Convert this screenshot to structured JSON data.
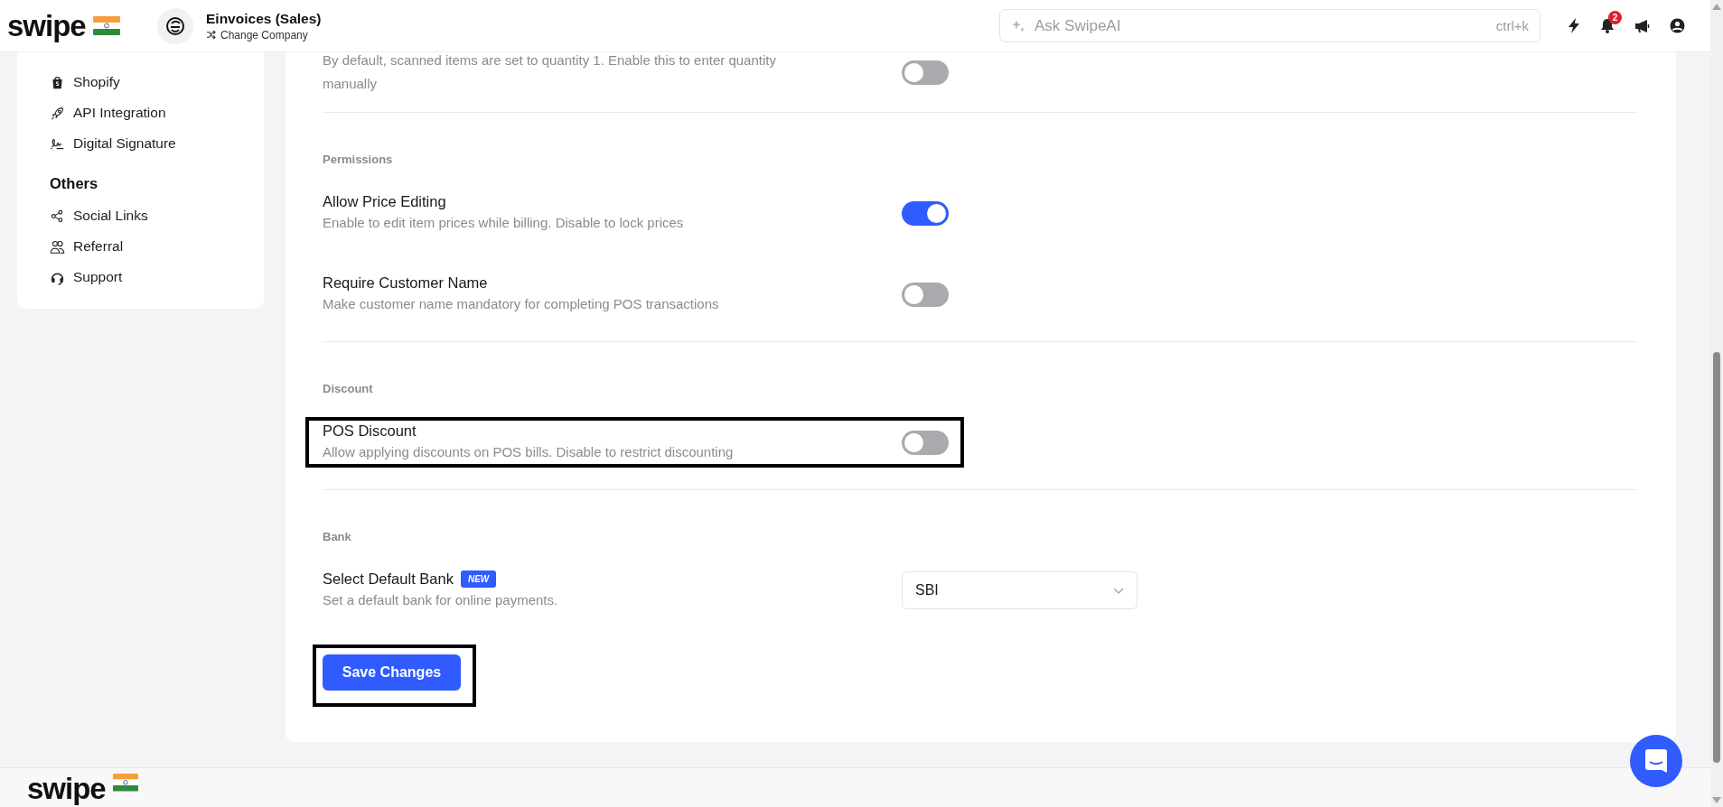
{
  "header": {
    "logo": "swipe",
    "company": {
      "name": "Einvoices (Sales)",
      "action": "Change Company"
    },
    "search": {
      "placeholder": "Ask SwipeAI",
      "shortcut": "ctrl+k"
    },
    "notifications": {
      "count": "2"
    }
  },
  "sidebar": {
    "groups": [
      {
        "items": [
          {
            "label": "Shopify"
          },
          {
            "label": "API Integration"
          },
          {
            "label": "Digital Signature"
          }
        ]
      },
      {
        "title": "Others",
        "items": [
          {
            "label": "Social Links"
          },
          {
            "label": "Referral"
          },
          {
            "label": "Support"
          }
        ]
      }
    ]
  },
  "settings": {
    "sections": [
      {
        "rows": [
          {
            "kind": "toggle",
            "description": "By default, scanned items are set to quantity 1. Enable this to enter quantity manually",
            "on": false,
            "highlighted": false
          }
        ]
      },
      {
        "title": "Permissions",
        "rows": [
          {
            "kind": "toggle",
            "title": "Allow Price Editing",
            "description": "Enable to edit item prices while billing. Disable to lock prices",
            "on": true,
            "highlighted": false
          },
          {
            "kind": "toggle",
            "title": "Require Customer Name",
            "description": "Make customer name mandatory for completing POS transactions",
            "on": false,
            "highlighted": false
          }
        ]
      },
      {
        "title": "Discount",
        "rows": [
          {
            "kind": "toggle",
            "title": "POS Discount",
            "description": "Allow applying discounts on POS bills. Disable to restrict discounting",
            "on": false,
            "highlighted": true
          }
        ]
      },
      {
        "title": "Bank",
        "rows": [
          {
            "kind": "select",
            "title": "Select Default Bank",
            "badge": "NEW",
            "description": "Set a default bank for online payments.",
            "value": "SBI",
            "highlighted": false
          }
        ]
      }
    ],
    "save_button": {
      "label": "Save Changes",
      "highlighted": true
    }
  },
  "footer": {
    "logo": "swipe"
  }
}
